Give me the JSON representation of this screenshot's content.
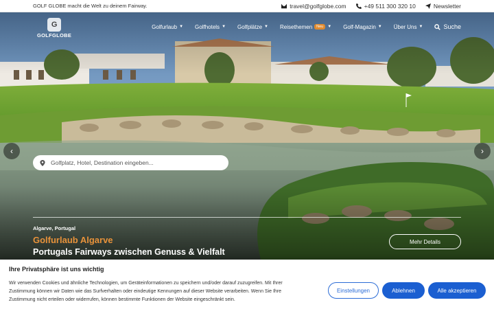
{
  "topbar": {
    "tagline": "GOLF GLOBE macht die Welt zu deinem Fairway.",
    "email": "travel@golfglobe.com",
    "phone": "+49 511 300 320 10",
    "newsletter": "Newsletter",
    "icons": [
      "envelope-icon",
      "phone-icon",
      "paper-plane-icon"
    ]
  },
  "logo": {
    "mark": "G",
    "wordmark": "GOLFGLOBE"
  },
  "nav": {
    "items": [
      {
        "label": "Golfurlaub"
      },
      {
        "label": "Golfhotels"
      },
      {
        "label": "Golfplätze"
      },
      {
        "label": "Reisethemen",
        "badge": "Neu"
      },
      {
        "label": "Golf-Magazin"
      },
      {
        "label": "Über Uns"
      }
    ],
    "search_label": "Suche"
  },
  "hero": {
    "search_placeholder": "Golfplatz, Hotel, Destination eingeben...",
    "location": "Algarve, Portugal",
    "title": "Golfurlaub Algarve",
    "subtitle": "Portugals Fairways zwischen Genuss & Vielfalt",
    "cta": "Mehr Details",
    "prev_arrow": "‹",
    "next_arrow": "›"
  },
  "cookie": {
    "heading": "Ihre Privatsphäre ist uns wichtig",
    "text": "Wir verwenden Cookies und ähnliche Technologien, um Geräteinformationen zu speichern und/oder darauf zuzugreifen. Mit Ihrer Zustimmung können wir Daten wie das Surfverhalten oder eindeutige Kennungen auf dieser Website verarbeiten. Wenn Sie Ihre Zustimmung nicht erteilen oder widerrufen, können bestimmte Funktionen der Website eingeschränkt sein.",
    "settings": "Einstellungen",
    "reject": "Ablehnen",
    "accept": "Alle akzeptieren"
  },
  "colors": {
    "accent_orange": "#e8923a",
    "button_blue": "#1b5fd1"
  }
}
